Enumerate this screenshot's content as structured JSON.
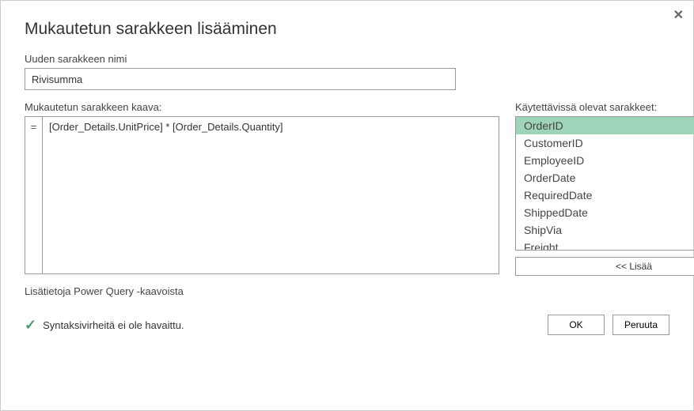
{
  "dialog": {
    "title": "Mukautetun sarakkeen lisääminen",
    "close": "✕",
    "name_label": "Uuden sarakkeen nimi",
    "name_value": "Rivisumma",
    "formula_label": "Mukautetun sarakkeen kaava:",
    "formula_prefix": "=",
    "formula_value": "[Order_Details.UnitPrice] * [Order_Details.Quantity]",
    "columns_label": "Käytettävissä olevat sarakkeet:",
    "columns": [
      "OrderID",
      "CustomerID",
      "EmployeeID",
      "OrderDate",
      "RequiredDate",
      "ShippedDate",
      "ShipVia",
      "Freight"
    ],
    "insert_btn": "<< Lisää",
    "link": "Lisätietoja Power Query -kaavoista",
    "status_text": "Syntaksivirheitä ei ole havaittu.",
    "ok": "OK",
    "cancel": "Peruuta"
  }
}
